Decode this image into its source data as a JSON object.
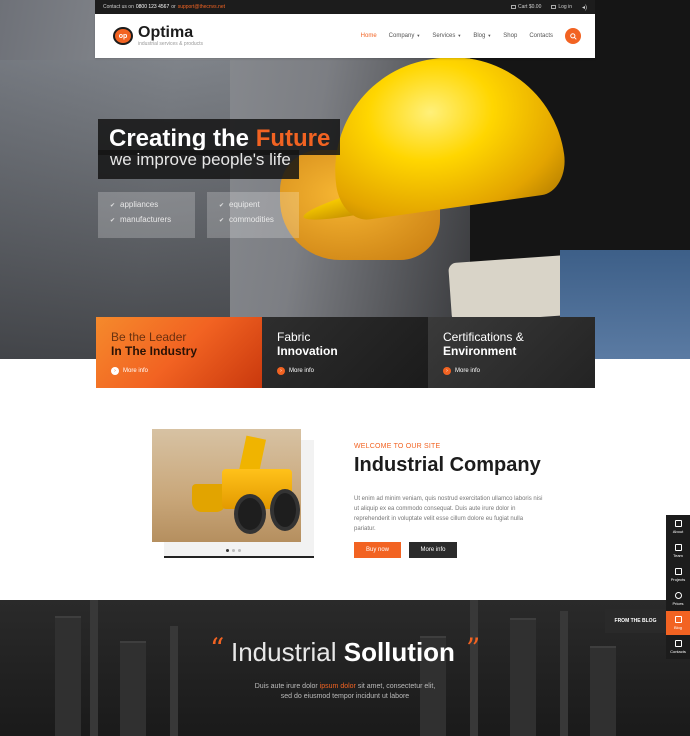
{
  "topbar": {
    "contact_prefix": "Contact us on",
    "phone": "0800 123 4567",
    "or": "or",
    "email": "support@thecnvs.net",
    "cart": "Cart $0.00",
    "login": "Log in"
  },
  "header": {
    "logo_mark": "op",
    "brand": "Optima",
    "tagline": "industrial services & products",
    "nav": [
      {
        "label": "Home",
        "active": true,
        "caret": false
      },
      {
        "label": "Company",
        "active": false,
        "caret": true
      },
      {
        "label": "Services",
        "active": false,
        "caret": true
      },
      {
        "label": "Blog",
        "active": false,
        "caret": true
      },
      {
        "label": "Shop",
        "active": false,
        "caret": false
      },
      {
        "label": "Contacts",
        "active": false,
        "caret": false
      }
    ]
  },
  "hero": {
    "title_main": "Creating the",
    "title_accent": "Future",
    "subtitle": "we improve people's life",
    "features_left": [
      "appliances",
      "manufacturers"
    ],
    "features_right": [
      "equipent",
      "commodities"
    ]
  },
  "panels": [
    {
      "line1": "Be the Leader",
      "line2": "In The Industry",
      "more": "More info"
    },
    {
      "line1": "Fabric",
      "line2": "Innovation",
      "more": "More info"
    },
    {
      "line1": "Certifications &",
      "line2": "Environment",
      "more": "More info"
    }
  ],
  "about": {
    "welcome": "WELCOME TO OUR SITE",
    "title": "Industrial Company",
    "text": "Ut enim ad minim veniam, quis nostrud exercitation ullamco laboris nisi ut aliquip ex ea commodo consequat. Duis aute irure dolor in reprehenderit in voluptate velit esse cillum dolore eu fugiat nulla pariatur.",
    "buy_label": "Buy now",
    "more_label": "More info"
  },
  "banner": {
    "title_light": "Industrial",
    "title_bold": "Sollution",
    "text_before": "Duis aute irure dolor",
    "text_accent": "ipsum dolor",
    "text_after": "sit amet, consectetur elit, sed do eiusmod tempor incidunt ut labore"
  },
  "dock": {
    "items": [
      "About",
      "Team",
      "Projects",
      "Prices",
      "Blog",
      "Contacts"
    ],
    "active": "Blog",
    "from_blog": "FROM THE BLOG"
  },
  "colors": {
    "accent": "#f26322",
    "dark": "#1c1c1c"
  }
}
